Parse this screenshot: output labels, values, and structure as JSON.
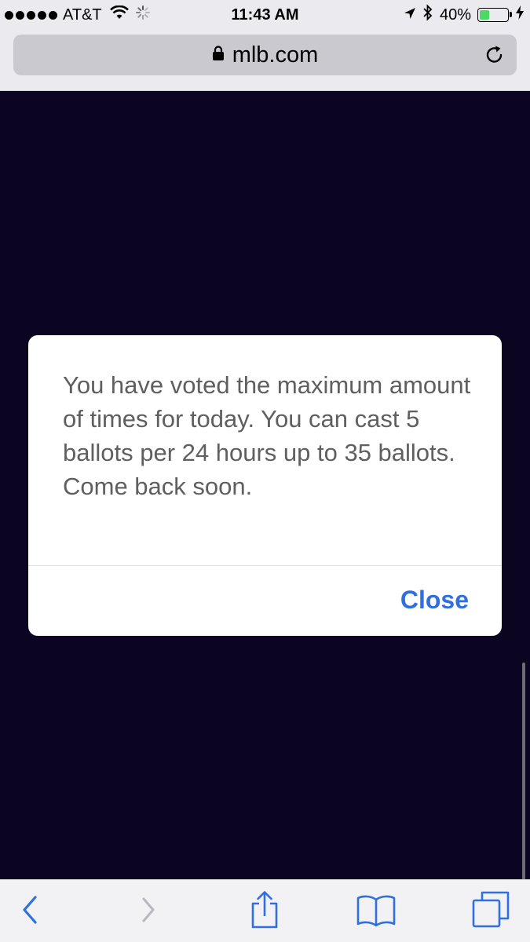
{
  "status_bar": {
    "carrier": "AT&T",
    "time": "11:43 AM",
    "battery_percent": "40%",
    "battery_level": 0.4,
    "signal_bars": 5
  },
  "url_bar": {
    "url": "mlb.com"
  },
  "alert": {
    "message": "You have voted the maximum amount of times for today. You can cast 5 ballots per 24 hours up to 35 ballots.  Come back soon.",
    "close_label": "Close"
  },
  "toolbar": {
    "icons": [
      "back-icon",
      "forward-icon",
      "share-icon",
      "bookmarks-icon",
      "tabs-icon"
    ]
  },
  "colors": {
    "page_background": "#0c0522",
    "chrome_background": "#ebebef",
    "accent_blue": "#2f6fe0",
    "battery_green": "#4cd964"
  }
}
